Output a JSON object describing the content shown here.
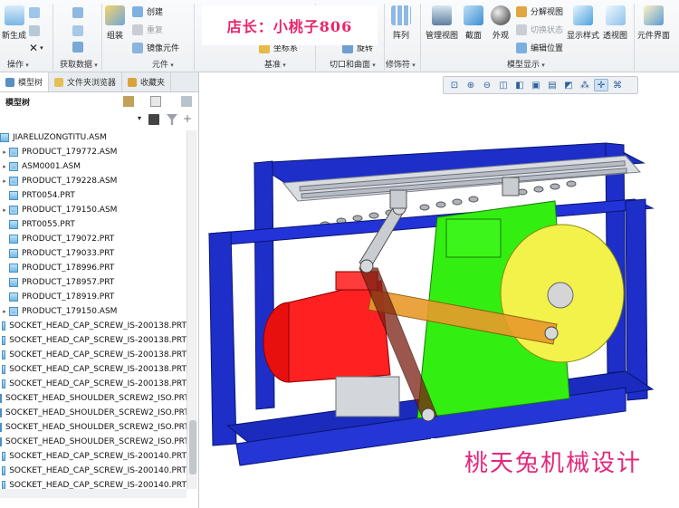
{
  "ribbon": {
    "buttons": {
      "new_generate": "新生成",
      "assemble": "组装",
      "create": "创建",
      "repeat": "重复",
      "mirror_component": "镜像元件",
      "coordinate_system": "坐标系",
      "rotate": "旋转",
      "array": "阵列",
      "manage_views": "管理视图",
      "section": "截面",
      "appearance": "外观",
      "exploded_view": "分解视图",
      "toggle_state": "切换状态",
      "edit_position": "编辑位置",
      "display_style": "显示样式",
      "perspective_view": "透视图",
      "component_interface": "元件界面"
    },
    "groups": {
      "operations": "操作",
      "get_data": "获取数据",
      "component": "元件",
      "datum": "基准",
      "cut_surface": "切口和曲面",
      "modifier": "修饰符",
      "model_display": "模型显示"
    },
    "shop_overlay": "店长：小桃子806"
  },
  "panel": {
    "tabs": [
      "模型树",
      "文件夹浏览器",
      "收藏夹"
    ],
    "header": "模型树",
    "tree": [
      {
        "label": "JIARELUZONGTITU.ASM",
        "type": "root"
      },
      {
        "label": "PRODUCT_179772.ASM",
        "type": "asm"
      },
      {
        "label": "ASM0001.ASM",
        "type": "asm"
      },
      {
        "label": "PRODUCT_179228.ASM",
        "type": "asm"
      },
      {
        "label": "PRT0054.PRT",
        "type": "prt"
      },
      {
        "label": "PRODUCT_179150.ASM",
        "type": "asm"
      },
      {
        "label": "PRT0055.PRT",
        "type": "prt"
      },
      {
        "label": "PRODUCT_179072.PRT",
        "type": "prt"
      },
      {
        "label": "PRODUCT_179033.PRT",
        "type": "prt"
      },
      {
        "label": "PRODUCT_178996.PRT",
        "type": "prt"
      },
      {
        "label": "PRODUCT_178957.PRT",
        "type": "prt"
      },
      {
        "label": "PRODUCT_178919.PRT",
        "type": "prt"
      },
      {
        "label": "PRODUCT_179150.ASM",
        "type": "asm"
      },
      {
        "label": "SOCKET_HEAD_CAP_SCREW_IS-200138.PRT",
        "type": "prt"
      },
      {
        "label": "SOCKET_HEAD_CAP_SCREW_IS-200138.PRT",
        "type": "prt"
      },
      {
        "label": "SOCKET_HEAD_CAP_SCREW_IS-200138.PRT",
        "type": "prt"
      },
      {
        "label": "SOCKET_HEAD_CAP_SCREW_IS-200138.PRT",
        "type": "prt"
      },
      {
        "label": "SOCKET_HEAD_CAP_SCREW_IS-200138.PRT",
        "type": "prt"
      },
      {
        "label": "SOCKET_HEAD_SHOULDER_SCREW2_ISO.PRT",
        "type": "prt"
      },
      {
        "label": "SOCKET_HEAD_SHOULDER_SCREW2_ISO.PRT",
        "type": "prt"
      },
      {
        "label": "SOCKET_HEAD_SHOULDER_SCREW2_ISO.PRT",
        "type": "prt"
      },
      {
        "label": "SOCKET_HEAD_SHOULDER_SCREW2_ISO.PRT",
        "type": "prt"
      },
      {
        "label": "SOCKET_HEAD_CAP_SCREW_IS-200140.PRT",
        "type": "prt"
      },
      {
        "label": "SOCKET_HEAD_CAP_SCREW_IS-200140.PRT",
        "type": "prt"
      },
      {
        "label": "SOCKET_HEAD_CAP_SCREW_IS-200140.PRT",
        "type": "prt"
      }
    ]
  },
  "viewport": {
    "watermark": "桃天兔机械设计"
  },
  "colors": {
    "frame": "#1d2fc8",
    "motor": "#ff1a1a",
    "gearbox": "#33ee11",
    "wheel": "#f2f24a",
    "link": "#e89a2a",
    "rollers": "#b8bcc4"
  }
}
